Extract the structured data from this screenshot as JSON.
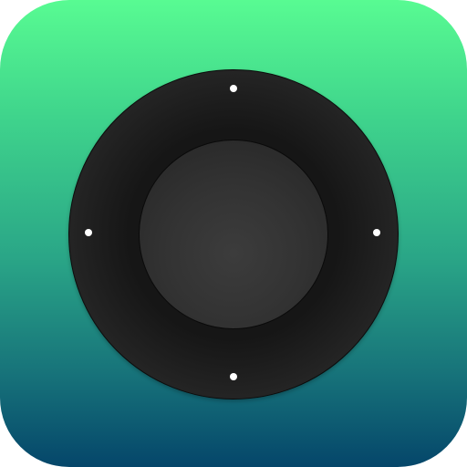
{
  "app": {
    "icon": "remote-control-dpad-icon",
    "colors": {
      "gradient_top": "#58fb92",
      "gradient_bottom": "#05466a",
      "dpad_ring": "#1a1a1a",
      "dpad_center": "#333333",
      "indicator_dot": "#ffffff"
    }
  },
  "dpad": {
    "buttons": [
      "up",
      "down",
      "left",
      "right",
      "select"
    ]
  }
}
